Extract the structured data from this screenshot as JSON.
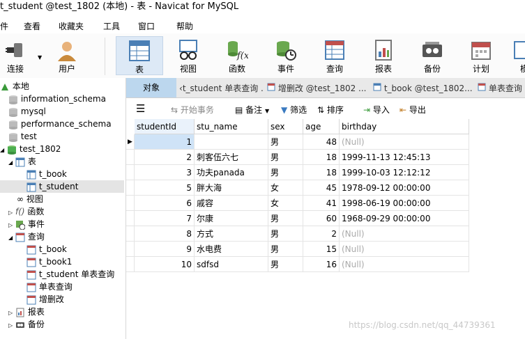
{
  "window": {
    "title": "t_student @test_1802 (本地) - 表 - Navicat for MySQL"
  },
  "menu": [
    "件",
    "查看",
    "收藏夹",
    "工具",
    "窗口",
    "帮助"
  ],
  "toolbar": [
    {
      "label": "连接",
      "icon": "connect-icon"
    },
    {
      "label": "用户",
      "icon": "user-icon"
    },
    {
      "label": "表",
      "icon": "table-icon",
      "active": true
    },
    {
      "label": "视图",
      "icon": "view-icon"
    },
    {
      "label": "函数",
      "icon": "function-icon"
    },
    {
      "label": "事件",
      "icon": "event-icon"
    },
    {
      "label": "查询",
      "icon": "query-icon"
    },
    {
      "label": "报表",
      "icon": "report-icon"
    },
    {
      "label": "备份",
      "icon": "backup-icon"
    },
    {
      "label": "计划",
      "icon": "schedule-icon"
    },
    {
      "label": "模",
      "icon": "model-icon"
    }
  ],
  "sidebar": {
    "connection": "本地",
    "databases": [
      "information_schema",
      "mysql",
      "performance_schema",
      "test",
      "test_1802"
    ],
    "table_group": "表",
    "tables": [
      "t_book",
      "t_student"
    ],
    "view_group": "视图",
    "function_group": "函数",
    "event_group": "事件",
    "query_group": "查询",
    "queries": [
      "t_book",
      "t_book1",
      "t_student 单表查询",
      "单表查询",
      "增删改"
    ],
    "report_group": "报表",
    "backup_group": "备份"
  },
  "tabs": {
    "object": "对象",
    "items": [
      "t_student 单表查询 ...",
      "增删改 @test_1802 ...",
      "t_book @test_1802...",
      "单表查询"
    ]
  },
  "subtoolbar": {
    "begin_transaction": "开始事务",
    "memo": "备注",
    "filter": "筛选",
    "sort": "排序",
    "import": "导入",
    "export": "导出"
  },
  "table": {
    "columns": [
      "studentId",
      "stu_name",
      "sex",
      "age",
      "birthday"
    ],
    "rows": [
      [
        "1",
        "",
        "男",
        "48",
        "(Null)"
      ],
      [
        "2",
        "刺客伍六七",
        "男",
        "18",
        "1999-11-13 12:45:13"
      ],
      [
        "3",
        "功夫panada",
        "男",
        "18",
        "1999-10-03 12:12:12"
      ],
      [
        "5",
        "胖大海",
        "女",
        "45",
        "1978-09-12 00:00:00"
      ],
      [
        "6",
        "戚容",
        "女",
        "41",
        "1998-06-19 00:00:00"
      ],
      [
        "7",
        "尔康",
        "男",
        "60",
        "1968-09-29 00:00:00"
      ],
      [
        "8",
        "方式",
        "男",
        "2",
        "(Null)"
      ],
      [
        "9",
        "水电费",
        "男",
        "15",
        "(Null)"
      ],
      [
        "10",
        "sdfsd",
        "男",
        "16",
        "(Null)"
      ]
    ]
  },
  "watermark": "https://blog.csdn.net/qq_44739361"
}
